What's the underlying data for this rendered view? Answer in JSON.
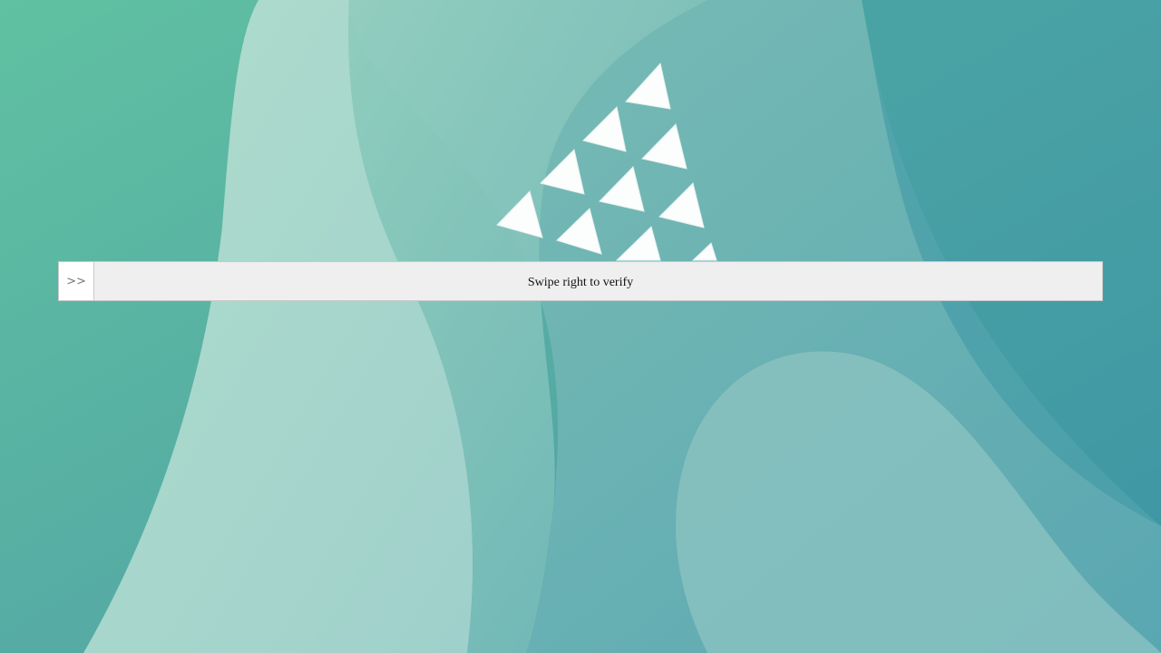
{
  "captcha": {
    "handle_icon": ">>",
    "instruction": "Swipe right to verify"
  },
  "colors": {
    "bg_left": "#5bbd9f",
    "bg_right": "#3a93a6",
    "track": "#efefef",
    "handle": "#ffffff"
  }
}
